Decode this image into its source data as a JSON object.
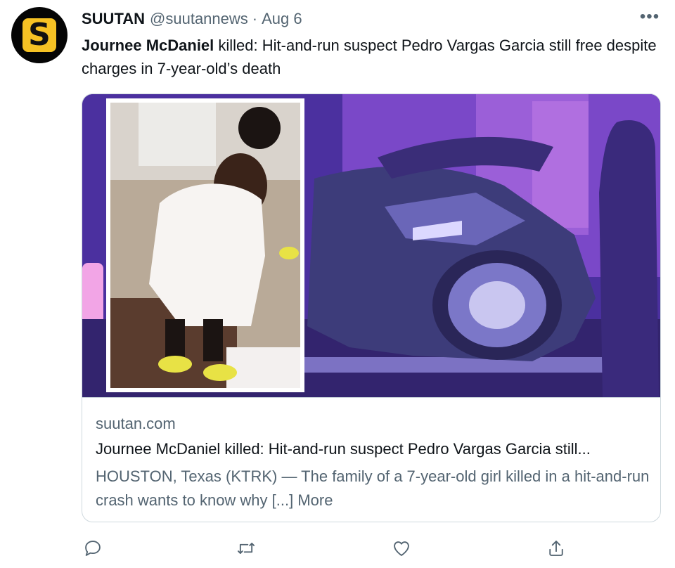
{
  "tweet": {
    "author_name": "SUUTAN",
    "handle": "@suutannews",
    "separator": "·",
    "date": "Aug 6",
    "more_glyph": "•••",
    "text_bold": "Journee McDaniel",
    "text_rest": " killed: Hit-and-run suspect Pedro Vargas Garcia still free despite charges in 7-year-old’s death",
    "avatar_letter": "S"
  },
  "card": {
    "domain": "suutan.com",
    "title": "Journee McDaniel killed: Hit-and-run suspect Pedro Vargas Garcia still...",
    "description": "HOUSTON, Texas (KTRK) — The family of a 7-year-old girl killed in a hit-and-run crash wants to know why [...] More"
  },
  "icons": {
    "reply": "reply-icon",
    "retweet": "retweet-icon",
    "like": "like-icon",
    "share": "share-icon"
  },
  "colors": {
    "secondary_text": "#536471",
    "primary_text": "#0f1419",
    "border": "#cfd9de",
    "logo_yellow": "#f6c224",
    "media_purple": "#4a2f9e"
  }
}
